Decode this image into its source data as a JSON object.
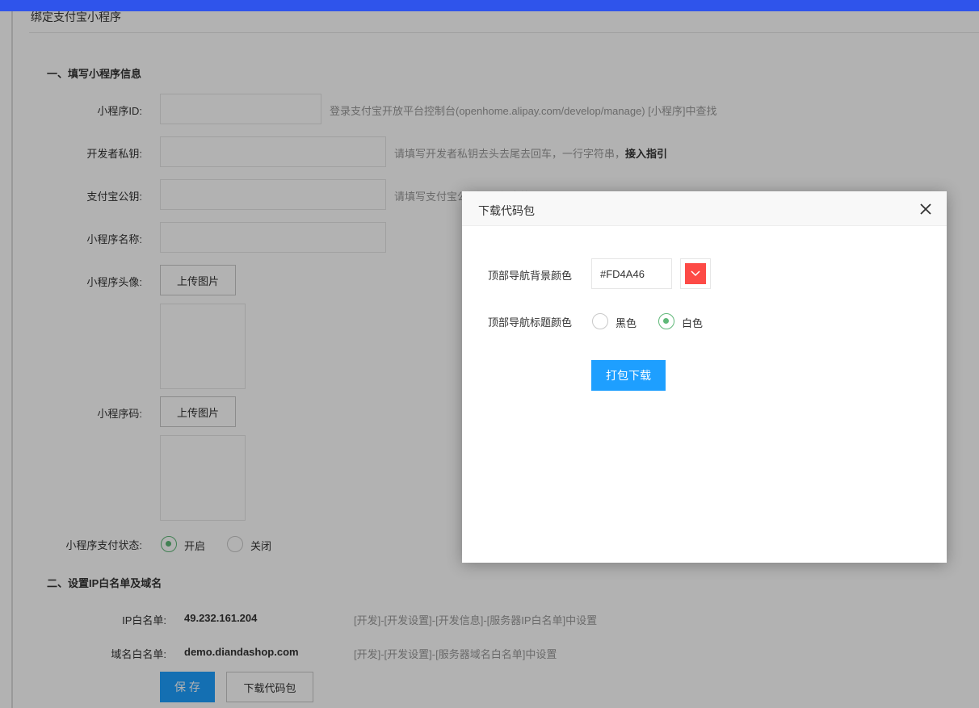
{
  "page": {
    "title": "绑定支付宝小程序",
    "section1_title": "一、填写小程序信息",
    "fields": {
      "appid_label": "小程序ID:",
      "appid_hint": "登录支付宝开放平台控制台(openhome.alipay.com/develop/manage) [小程序]中查找",
      "private_key_label": "开发者私钥:",
      "private_key_hint": "请填写开发者私钥去头去尾去回车，一行字符串，",
      "private_key_hint_link": "接入指引",
      "public_key_label": "支付宝公钥:",
      "public_key_hint": "请填写支付宝公钥，一行字符串",
      "name_label": "小程序名称:",
      "avatar_label": "小程序头像:",
      "avatar_upload": "上传图片",
      "code_label": "小程序码:",
      "code_upload": "上传图片",
      "pay_status_label": "小程序支付状态:",
      "pay_on": "开启",
      "pay_off": "关闭"
    },
    "section2_title": "二、设置IP白名单及域名",
    "ip_label": "IP白名单:",
    "ip_value": "49.232.161.204",
    "ip_hint": "[开发]-[开发设置]-[开发信息]-[服务器IP白名单]中设置",
    "domain_label": "域名白名单:",
    "domain_value": "demo.diandashop.com",
    "domain_hint": "[开发]-[开发设置]-[服务器域名白名单]中设置",
    "save_button": "保 存",
    "download_button": "下载代码包"
  },
  "modal": {
    "title": "下载代码包",
    "bg_color_label": "顶部导航背景颜色",
    "bg_color_value": "#FD4A46",
    "title_color_label": "顶部导航标题颜色",
    "option_black": "黑色",
    "option_white": "白色",
    "selected_option": "白色",
    "submit_button": "打包下载"
  },
  "colors": {
    "accent_blue": "#1E9FFF",
    "radio_green": "#5FB878",
    "swatch_red": "#FD4A46"
  }
}
